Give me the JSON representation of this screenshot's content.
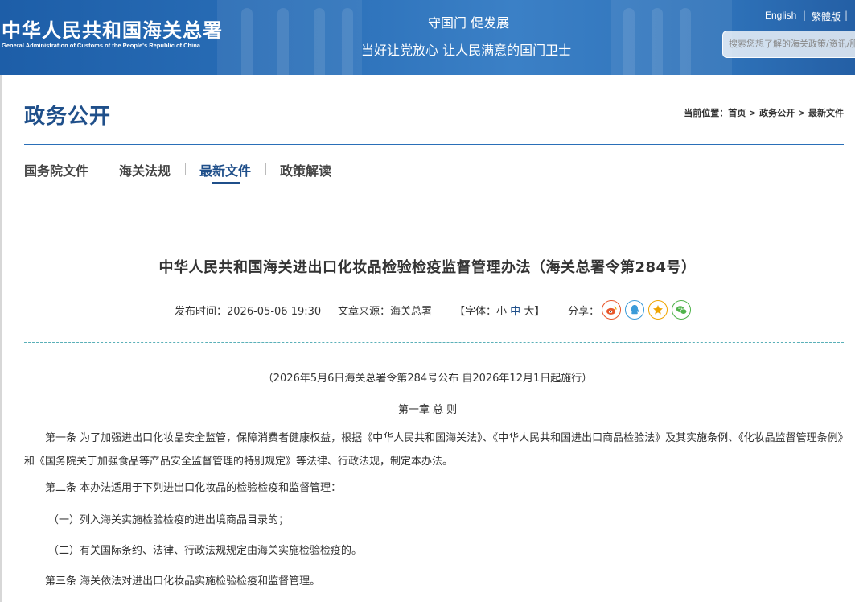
{
  "header": {
    "logo_cn": "中华人民共和国海关总署",
    "logo_en": "General Administration of Customs of the People's Republic of China",
    "slogan_line1": "守国门   促发展",
    "slogan_line2": "当好让党放心   让人民满意的国门卫士",
    "lang_english": "English",
    "lang_traditional": "繁體版",
    "search_placeholder": "搜索您想了解的海关政策/资讯/服务"
  },
  "section": {
    "title": "政务公开",
    "breadcrumb_prefix": "当前位置：",
    "breadcrumb": [
      "首页",
      "政务公开",
      "最新文件"
    ],
    "breadcrumb_sep": " > "
  },
  "tabs": [
    {
      "label": "国务院文件",
      "active": false
    },
    {
      "label": "海关法规",
      "active": false
    },
    {
      "label": "最新文件",
      "active": true
    },
    {
      "label": "政策解读",
      "active": false
    }
  ],
  "article": {
    "title": "中华人民共和国海关进出口化妆品检验检疫监督管理办法（海关总署令第284号）",
    "publish_label": "发布时间：",
    "publish_time": "2026-05-06 19:30",
    "source_label": "文章来源：",
    "source": "海关总署",
    "font_label_open": "【字体：",
    "font_small": "小",
    "font_mid": "中",
    "font_large": "大",
    "font_label_close": "】",
    "share_label": "分享：",
    "share_icons": [
      "weibo-icon",
      "qq-icon",
      "qzone-icon",
      "wechat-icon"
    ],
    "share_colors": [
      "#e8562a",
      "#3a9bd9",
      "#f0a500",
      "#4fb34a"
    ],
    "subtitle": "（2026年5月6日海关总署令第284号公布 自2026年12月1日起施行）",
    "chapter": "第一章  总    则",
    "para1": "第一条 为了加强进出口化妆品安全监管，保障消费者健康权益，根据《中华人民共和国海关法》、《中华人民共和国进出口商品检验法》及其实施条例、《化妆品监督管理条例》和《国务院关于加强食品等产品安全监督管理的特别规定》等法律、行政法规，制定本办法。",
    "para2": "第二条 本办法适用于下列进出口化妆品的检验检疫和监督管理：",
    "item1": "（一）列入海关实施检验检疫的进出境商品目录的；",
    "item2": "（二）有关国际条约、法律、行政法规规定由海关实施检验检疫的。",
    "para3": "第三条 海关依法对进出口化妆品实施检验检疫和监督管理。"
  }
}
